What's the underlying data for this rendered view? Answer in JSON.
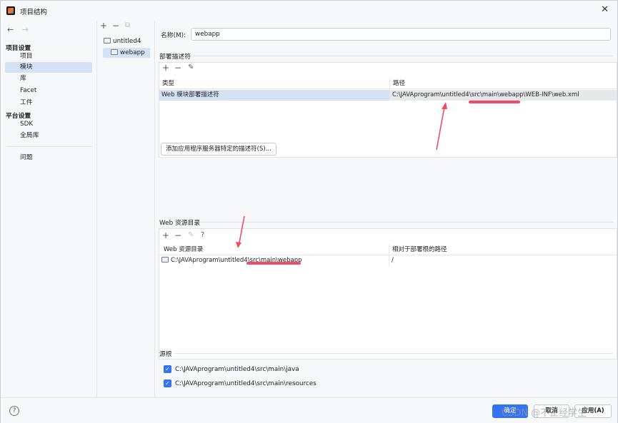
{
  "window": {
    "title": "项目结构",
    "close_glyph": "✕"
  },
  "sidebar": {
    "back_glyph": "←",
    "forward_glyph": "→",
    "project_settings_title": "项目设置",
    "items": [
      {
        "label": "项目"
      },
      {
        "label": "模块"
      },
      {
        "label": "库"
      },
      {
        "label": "Facet"
      },
      {
        "label": "工件"
      }
    ],
    "platform_settings_title": "平台设置",
    "platform_items": [
      {
        "label": "SDK"
      },
      {
        "label": "全局库"
      }
    ],
    "problems_label": "问题"
  },
  "modules": {
    "add_glyph": "+",
    "remove_glyph": "−",
    "copy_glyph": "⧉",
    "tree": [
      {
        "label": "untitled4"
      },
      {
        "label": "webapp"
      }
    ]
  },
  "main": {
    "name_label": "名称(M):",
    "name_value": "webapp",
    "deploy_section_title": "部署描述符",
    "toolbar_add": "+",
    "toolbar_remove": "−",
    "toolbar_edit": "✎",
    "toolbar_help": "?",
    "deploy_table": {
      "headers": [
        "类型",
        "路径"
      ],
      "rows": [
        {
          "type": "Web 模块部署描述符",
          "path": "C:\\JAVAprogram\\untitled4\\src\\main\\webapp\\WEB-INF\\web.xml"
        }
      ]
    },
    "add_descriptor_button": "添加应用程序服务器特定的描述符(S)...",
    "web_resource_section_title": "Web 资源目录",
    "resource_table": {
      "headers": [
        "Web 资源目录",
        "相对于部署根的路径"
      ],
      "rows": [
        {
          "dir": "C:\\JAVAprogram\\untitled4\\src\\main\\webapp",
          "relpath": "/"
        }
      ]
    },
    "source_roots_title": "源根",
    "source_roots": [
      {
        "path": "C:\\JAVAprogram\\untitled4\\src\\main\\java",
        "checked": true
      },
      {
        "path": "C:\\JAVAprogram\\untitled4\\src\\main\\resources",
        "checked": true
      }
    ]
  },
  "footer": {
    "help_glyph": "?",
    "ok_label": "确定",
    "cancel_label": "取消",
    "apply_label": "应用(A)"
  },
  "watermark": "CSDN @不正经学生",
  "colors": {
    "accent": "#3574f0",
    "selection": "#d5e1f5",
    "annotation": "#f24b66"
  }
}
